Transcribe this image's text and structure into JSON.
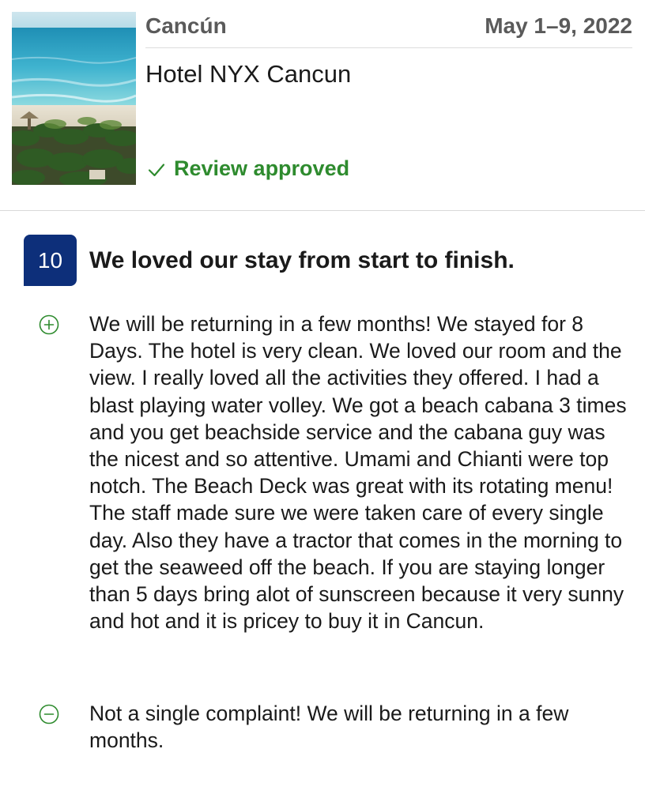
{
  "header": {
    "location": "Cancún",
    "dates": "May 1–9, 2022",
    "hotel_name": "Hotel NYX Cancun",
    "status_label": "Review approved",
    "thumbnail": "beach-palm-trees-photo"
  },
  "review": {
    "score": "10",
    "title": "We loved our stay from start to finish.",
    "positive": "We will be returning in a few months! We stayed for 8 Days. The hotel is very clean. We loved our room and the view. I really loved all the activities they offered. I had a blast playing water volley. We got a beach cabana 3 times and you get beachside service and the cabana guy was the nicest and so attentive. Umami and Chianti were top notch. The Beach Deck was great with its rotating menu! The staff made sure we were taken care of every single day. Also they have a tractor that comes in the morning to get the seaweed off the beach. If you are staying longer than 5 days bring alot of sunscreen because it very sunny and hot and it is pricey to buy it in Cancun.",
    "negative": "Not a single complaint! We will be returning in a few months."
  },
  "icons": {
    "status": "check-icon",
    "positive": "plus-circle-icon",
    "negative": "minus-circle-icon"
  },
  "colors": {
    "score_badge": "#0d2f7a",
    "approved_green": "#2e8b2e",
    "secondary_text": "#5a5a5a"
  }
}
